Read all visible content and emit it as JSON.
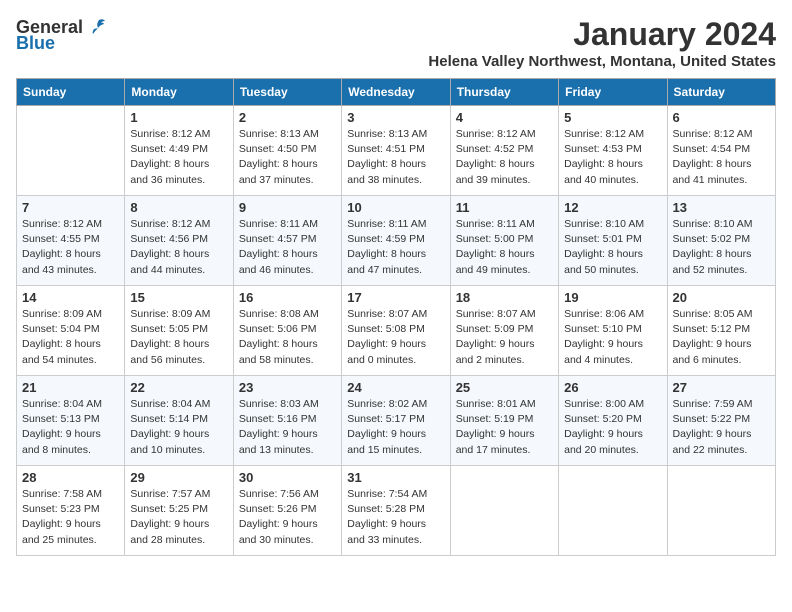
{
  "logo": {
    "general": "General",
    "blue": "Blue"
  },
  "title": "January 2024",
  "location": "Helena Valley Northwest, Montana, United States",
  "days_of_week": [
    "Sunday",
    "Monday",
    "Tuesday",
    "Wednesday",
    "Thursday",
    "Friday",
    "Saturday"
  ],
  "weeks": [
    [
      {
        "day": "",
        "sunrise": "",
        "sunset": "",
        "daylight": ""
      },
      {
        "day": "1",
        "sunrise": "Sunrise: 8:12 AM",
        "sunset": "Sunset: 4:49 PM",
        "daylight": "Daylight: 8 hours and 36 minutes."
      },
      {
        "day": "2",
        "sunrise": "Sunrise: 8:13 AM",
        "sunset": "Sunset: 4:50 PM",
        "daylight": "Daylight: 8 hours and 37 minutes."
      },
      {
        "day": "3",
        "sunrise": "Sunrise: 8:13 AM",
        "sunset": "Sunset: 4:51 PM",
        "daylight": "Daylight: 8 hours and 38 minutes."
      },
      {
        "day": "4",
        "sunrise": "Sunrise: 8:12 AM",
        "sunset": "Sunset: 4:52 PM",
        "daylight": "Daylight: 8 hours and 39 minutes."
      },
      {
        "day": "5",
        "sunrise": "Sunrise: 8:12 AM",
        "sunset": "Sunset: 4:53 PM",
        "daylight": "Daylight: 8 hours and 40 minutes."
      },
      {
        "day": "6",
        "sunrise": "Sunrise: 8:12 AM",
        "sunset": "Sunset: 4:54 PM",
        "daylight": "Daylight: 8 hours and 41 minutes."
      }
    ],
    [
      {
        "day": "7",
        "sunrise": "Sunrise: 8:12 AM",
        "sunset": "Sunset: 4:55 PM",
        "daylight": "Daylight: 8 hours and 43 minutes."
      },
      {
        "day": "8",
        "sunrise": "Sunrise: 8:12 AM",
        "sunset": "Sunset: 4:56 PM",
        "daylight": "Daylight: 8 hours and 44 minutes."
      },
      {
        "day": "9",
        "sunrise": "Sunrise: 8:11 AM",
        "sunset": "Sunset: 4:57 PM",
        "daylight": "Daylight: 8 hours and 46 minutes."
      },
      {
        "day": "10",
        "sunrise": "Sunrise: 8:11 AM",
        "sunset": "Sunset: 4:59 PM",
        "daylight": "Daylight: 8 hours and 47 minutes."
      },
      {
        "day": "11",
        "sunrise": "Sunrise: 8:11 AM",
        "sunset": "Sunset: 5:00 PM",
        "daylight": "Daylight: 8 hours and 49 minutes."
      },
      {
        "day": "12",
        "sunrise": "Sunrise: 8:10 AM",
        "sunset": "Sunset: 5:01 PM",
        "daylight": "Daylight: 8 hours and 50 minutes."
      },
      {
        "day": "13",
        "sunrise": "Sunrise: 8:10 AM",
        "sunset": "Sunset: 5:02 PM",
        "daylight": "Daylight: 8 hours and 52 minutes."
      }
    ],
    [
      {
        "day": "14",
        "sunrise": "Sunrise: 8:09 AM",
        "sunset": "Sunset: 5:04 PM",
        "daylight": "Daylight: 8 hours and 54 minutes."
      },
      {
        "day": "15",
        "sunrise": "Sunrise: 8:09 AM",
        "sunset": "Sunset: 5:05 PM",
        "daylight": "Daylight: 8 hours and 56 minutes."
      },
      {
        "day": "16",
        "sunrise": "Sunrise: 8:08 AM",
        "sunset": "Sunset: 5:06 PM",
        "daylight": "Daylight: 8 hours and 58 minutes."
      },
      {
        "day": "17",
        "sunrise": "Sunrise: 8:07 AM",
        "sunset": "Sunset: 5:08 PM",
        "daylight": "Daylight: 9 hours and 0 minutes."
      },
      {
        "day": "18",
        "sunrise": "Sunrise: 8:07 AM",
        "sunset": "Sunset: 5:09 PM",
        "daylight": "Daylight: 9 hours and 2 minutes."
      },
      {
        "day": "19",
        "sunrise": "Sunrise: 8:06 AM",
        "sunset": "Sunset: 5:10 PM",
        "daylight": "Daylight: 9 hours and 4 minutes."
      },
      {
        "day": "20",
        "sunrise": "Sunrise: 8:05 AM",
        "sunset": "Sunset: 5:12 PM",
        "daylight": "Daylight: 9 hours and 6 minutes."
      }
    ],
    [
      {
        "day": "21",
        "sunrise": "Sunrise: 8:04 AM",
        "sunset": "Sunset: 5:13 PM",
        "daylight": "Daylight: 9 hours and 8 minutes."
      },
      {
        "day": "22",
        "sunrise": "Sunrise: 8:04 AM",
        "sunset": "Sunset: 5:14 PM",
        "daylight": "Daylight: 9 hours and 10 minutes."
      },
      {
        "day": "23",
        "sunrise": "Sunrise: 8:03 AM",
        "sunset": "Sunset: 5:16 PM",
        "daylight": "Daylight: 9 hours and 13 minutes."
      },
      {
        "day": "24",
        "sunrise": "Sunrise: 8:02 AM",
        "sunset": "Sunset: 5:17 PM",
        "daylight": "Daylight: 9 hours and 15 minutes."
      },
      {
        "day": "25",
        "sunrise": "Sunrise: 8:01 AM",
        "sunset": "Sunset: 5:19 PM",
        "daylight": "Daylight: 9 hours and 17 minutes."
      },
      {
        "day": "26",
        "sunrise": "Sunrise: 8:00 AM",
        "sunset": "Sunset: 5:20 PM",
        "daylight": "Daylight: 9 hours and 20 minutes."
      },
      {
        "day": "27",
        "sunrise": "Sunrise: 7:59 AM",
        "sunset": "Sunset: 5:22 PM",
        "daylight": "Daylight: 9 hours and 22 minutes."
      }
    ],
    [
      {
        "day": "28",
        "sunrise": "Sunrise: 7:58 AM",
        "sunset": "Sunset: 5:23 PM",
        "daylight": "Daylight: 9 hours and 25 minutes."
      },
      {
        "day": "29",
        "sunrise": "Sunrise: 7:57 AM",
        "sunset": "Sunset: 5:25 PM",
        "daylight": "Daylight: 9 hours and 28 minutes."
      },
      {
        "day": "30",
        "sunrise": "Sunrise: 7:56 AM",
        "sunset": "Sunset: 5:26 PM",
        "daylight": "Daylight: 9 hours and 30 minutes."
      },
      {
        "day": "31",
        "sunrise": "Sunrise: 7:54 AM",
        "sunset": "Sunset: 5:28 PM",
        "daylight": "Daylight: 9 hours and 33 minutes."
      },
      {
        "day": "",
        "sunrise": "",
        "sunset": "",
        "daylight": ""
      },
      {
        "day": "",
        "sunrise": "",
        "sunset": "",
        "daylight": ""
      },
      {
        "day": "",
        "sunrise": "",
        "sunset": "",
        "daylight": ""
      }
    ]
  ]
}
